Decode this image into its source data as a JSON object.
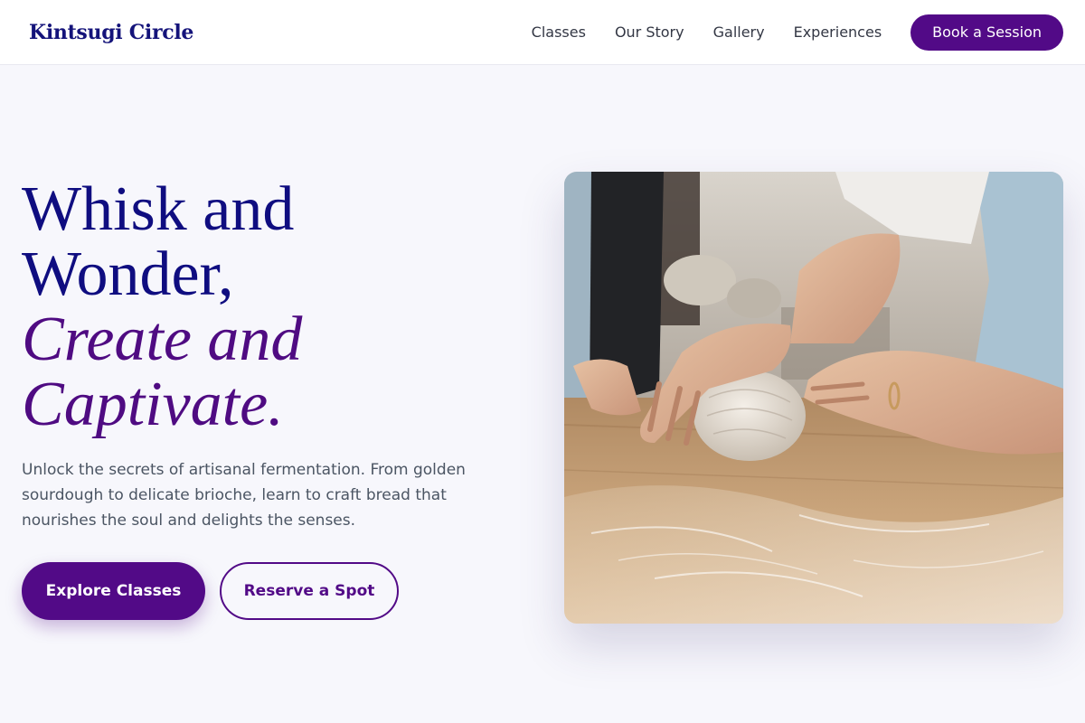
{
  "brand": {
    "name": "Kintsugi Circle"
  },
  "nav": {
    "links": [
      "Classes",
      "Our Story",
      "Gallery",
      "Experiences"
    ],
    "cta_label": "Book a Session"
  },
  "hero": {
    "title_line1": "Whisk and",
    "title_line2": "Wonder,",
    "title_accent_line1": "Create and",
    "title_accent_line2": "Captivate.",
    "description": "Unlock the secrets of artisanal fermentation. From golden sourdough to delicate brioche, learn to craft bread that nourishes the soul and delights the senses.",
    "primary_cta": "Explore Classes",
    "secondary_cta": "Reserve a Spot"
  },
  "colors": {
    "primary": "#520a87",
    "title": "#0f0d80",
    "background": "#f7f7fc"
  }
}
